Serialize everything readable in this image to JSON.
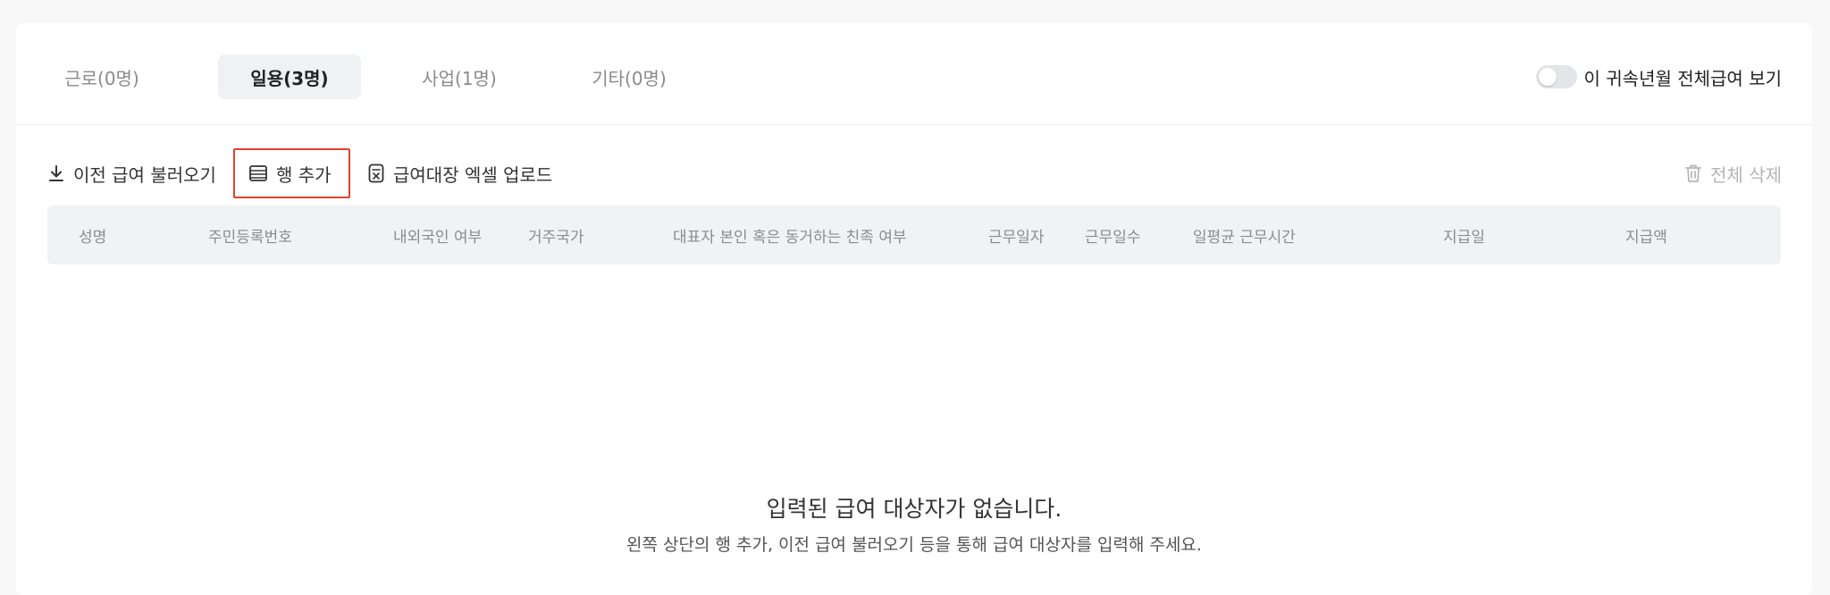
{
  "tabs": [
    {
      "label": "근로(0명)",
      "active": false
    },
    {
      "label": "일용(3명)",
      "active": true
    },
    {
      "label": "사업(1명)",
      "active": false
    },
    {
      "label": "기타(0명)",
      "active": false
    }
  ],
  "toggle": {
    "label": "이 귀속년월 전체급여 보기",
    "on": false
  },
  "toolbar": {
    "load_previous": "이전 급여 불러오기",
    "add_row": "행 추가",
    "excel_upload": "급여대장 엑셀 업로드",
    "delete_all": "전체 삭제"
  },
  "table": {
    "columns": [
      "성명",
      "주민등록번호",
      "내외국인 여부",
      "거주국가",
      "대표자 본인 혹은 동거하는 친족 여부",
      "근무일자",
      "근무일수",
      "일평균 근무시간",
      "지급일",
      "지급액"
    ]
  },
  "empty": {
    "title": "입력된 급여 대상자가 없습니다.",
    "description": "왼쪽 상단의 행 추가, 이전 급여 불러오기 등을 통해 급여 대상자를 입력해 주세요."
  },
  "colors": {
    "highlight": "#e0432c",
    "active_tab_bg": "#f0f1f3",
    "header_bg": "#f1f2f4"
  }
}
